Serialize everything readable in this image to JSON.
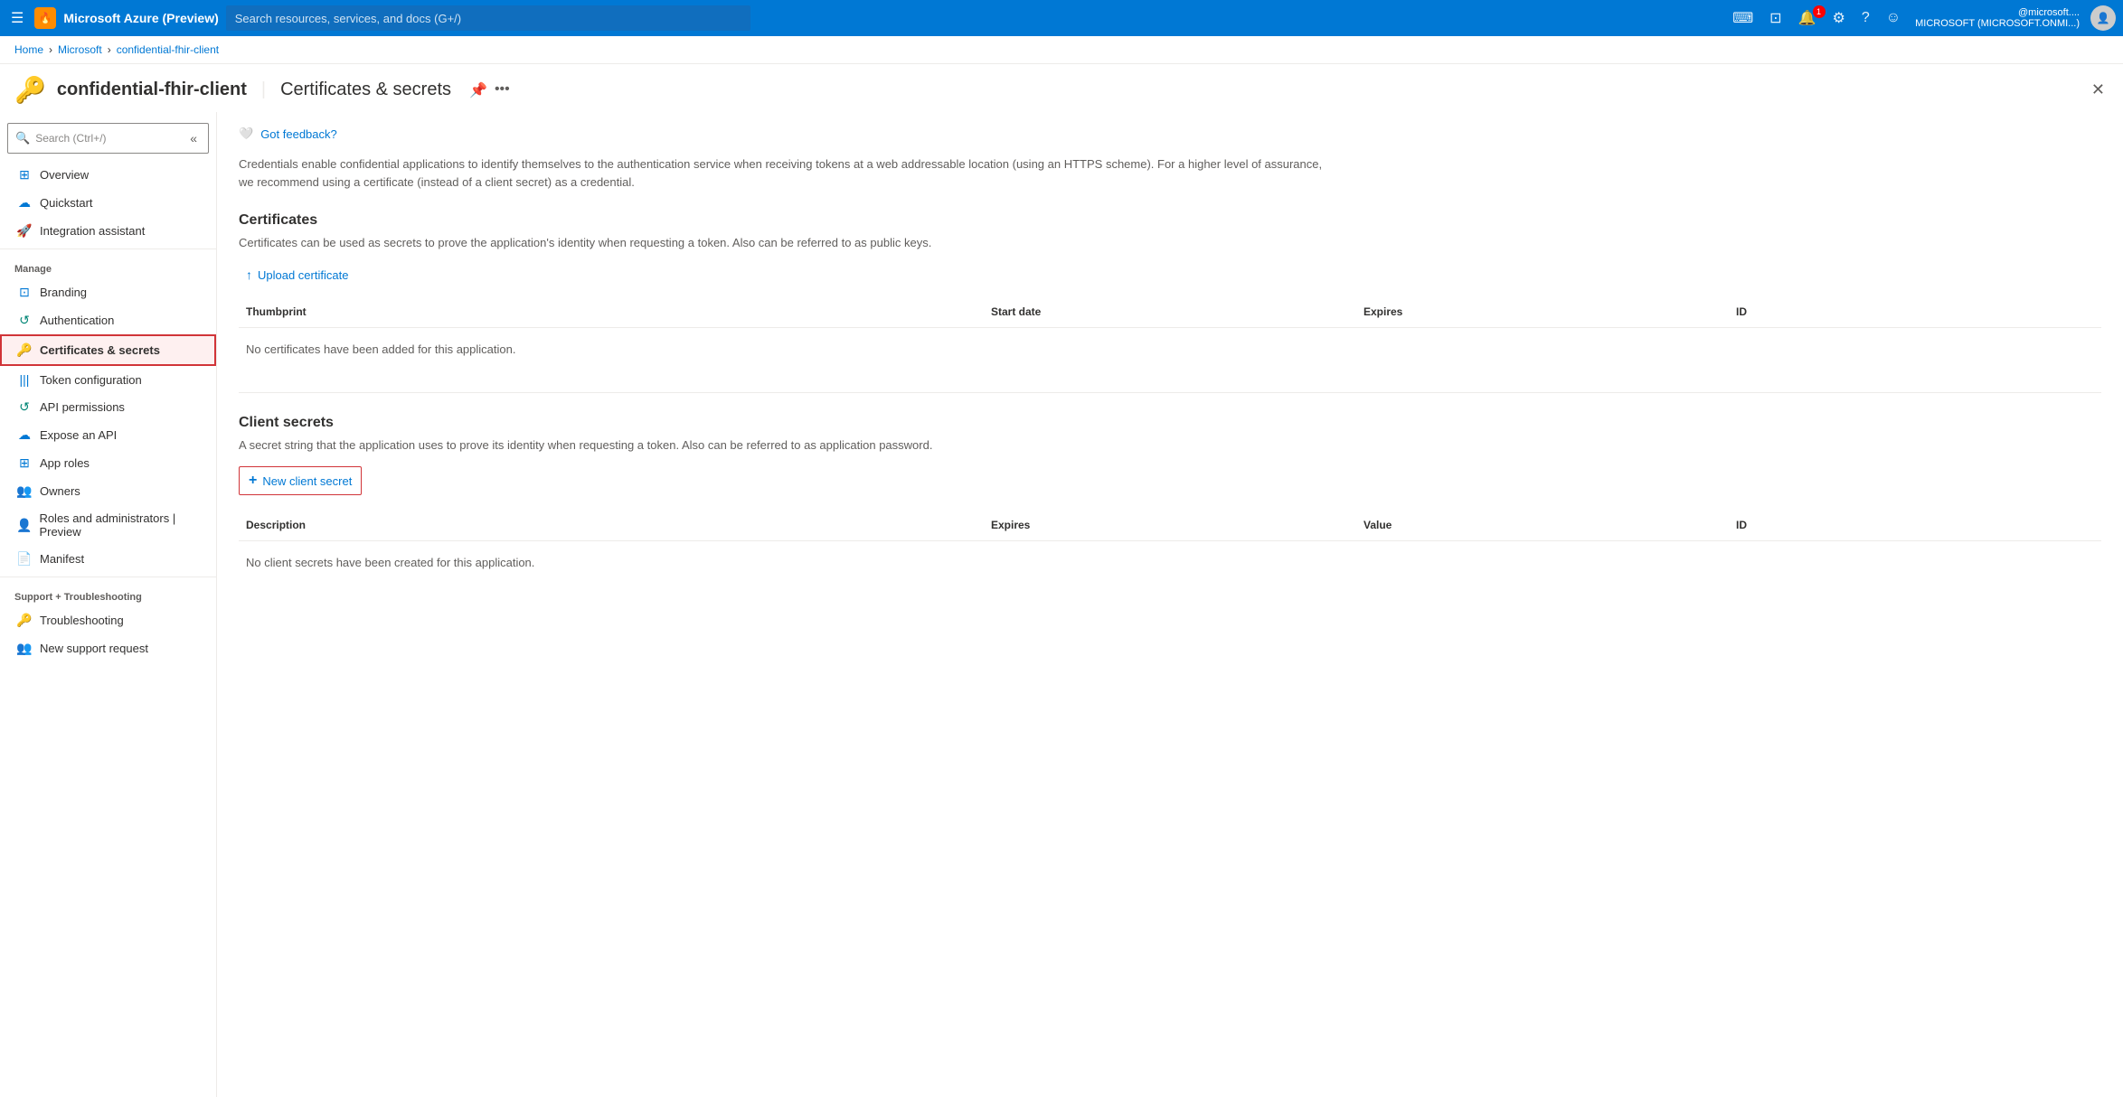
{
  "topbar": {
    "title": "Microsoft Azure (Preview)",
    "logo_text": "🔥",
    "search_placeholder": "Search resources, services, and docs (G+/)",
    "user_account": "@microsoft....",
    "user_tenant": "MICROSOFT (MICROSOFT.ONMI...)",
    "notification_count": "1"
  },
  "breadcrumb": {
    "items": [
      "Home",
      "Microsoft",
      "confidential-fhir-client"
    ]
  },
  "page_header": {
    "title": "confidential-fhir-client",
    "subtitle": "Certificates & secrets",
    "pin_icon": "📌",
    "more_icon": "..."
  },
  "sidebar": {
    "search_placeholder": "Search (Ctrl+/)",
    "items": [
      {
        "id": "overview",
        "label": "Overview",
        "icon": "⊞"
      },
      {
        "id": "quickstart",
        "label": "Quickstart",
        "icon": "☁"
      },
      {
        "id": "integration",
        "label": "Integration assistant",
        "icon": "🚀"
      }
    ],
    "manage_section": "Manage",
    "manage_items": [
      {
        "id": "branding",
        "label": "Branding",
        "icon": "⊡"
      },
      {
        "id": "authentication",
        "label": "Authentication",
        "icon": "↺"
      },
      {
        "id": "certificates",
        "label": "Certificates & secrets",
        "icon": "🔑",
        "active": true
      },
      {
        "id": "token",
        "label": "Token configuration",
        "icon": "|||"
      },
      {
        "id": "api",
        "label": "API permissions",
        "icon": "↺"
      },
      {
        "id": "expose",
        "label": "Expose an API",
        "icon": "☁"
      },
      {
        "id": "approles",
        "label": "App roles",
        "icon": "⊞"
      },
      {
        "id": "owners",
        "label": "Owners",
        "icon": "👥"
      },
      {
        "id": "roles",
        "label": "Roles and administrators | Preview",
        "icon": "👤"
      },
      {
        "id": "manifest",
        "label": "Manifest",
        "icon": "📄"
      }
    ],
    "support_section": "Support + Troubleshooting",
    "support_items": [
      {
        "id": "troubleshooting",
        "label": "Troubleshooting",
        "icon": "🔑"
      },
      {
        "id": "support",
        "label": "New support request",
        "icon": "👥"
      }
    ]
  },
  "content": {
    "feedback_text": "Got feedback?",
    "description": "Credentials enable confidential applications to identify themselves to the authentication service when receiving tokens at a web addressable location (using an HTTPS scheme). For a higher level of assurance, we recommend using a certificate (instead of a client secret) as a credential.",
    "certificates": {
      "title": "Certificates",
      "description": "Certificates can be used as secrets to prove the application's identity when requesting a token. Also can be referred to as public keys.",
      "upload_button": "Upload certificate",
      "columns": [
        "Thumbprint",
        "Start date",
        "Expires",
        "ID"
      ],
      "empty_message": "No certificates have been added for this application."
    },
    "client_secrets": {
      "title": "Client secrets",
      "description": "A secret string that the application uses to prove its identity when requesting a token. Also can be referred to as application password.",
      "new_button": "New client secret",
      "columns": [
        "Description",
        "Expires",
        "Value",
        "ID"
      ],
      "empty_message": "No client secrets have been created for this application."
    }
  }
}
